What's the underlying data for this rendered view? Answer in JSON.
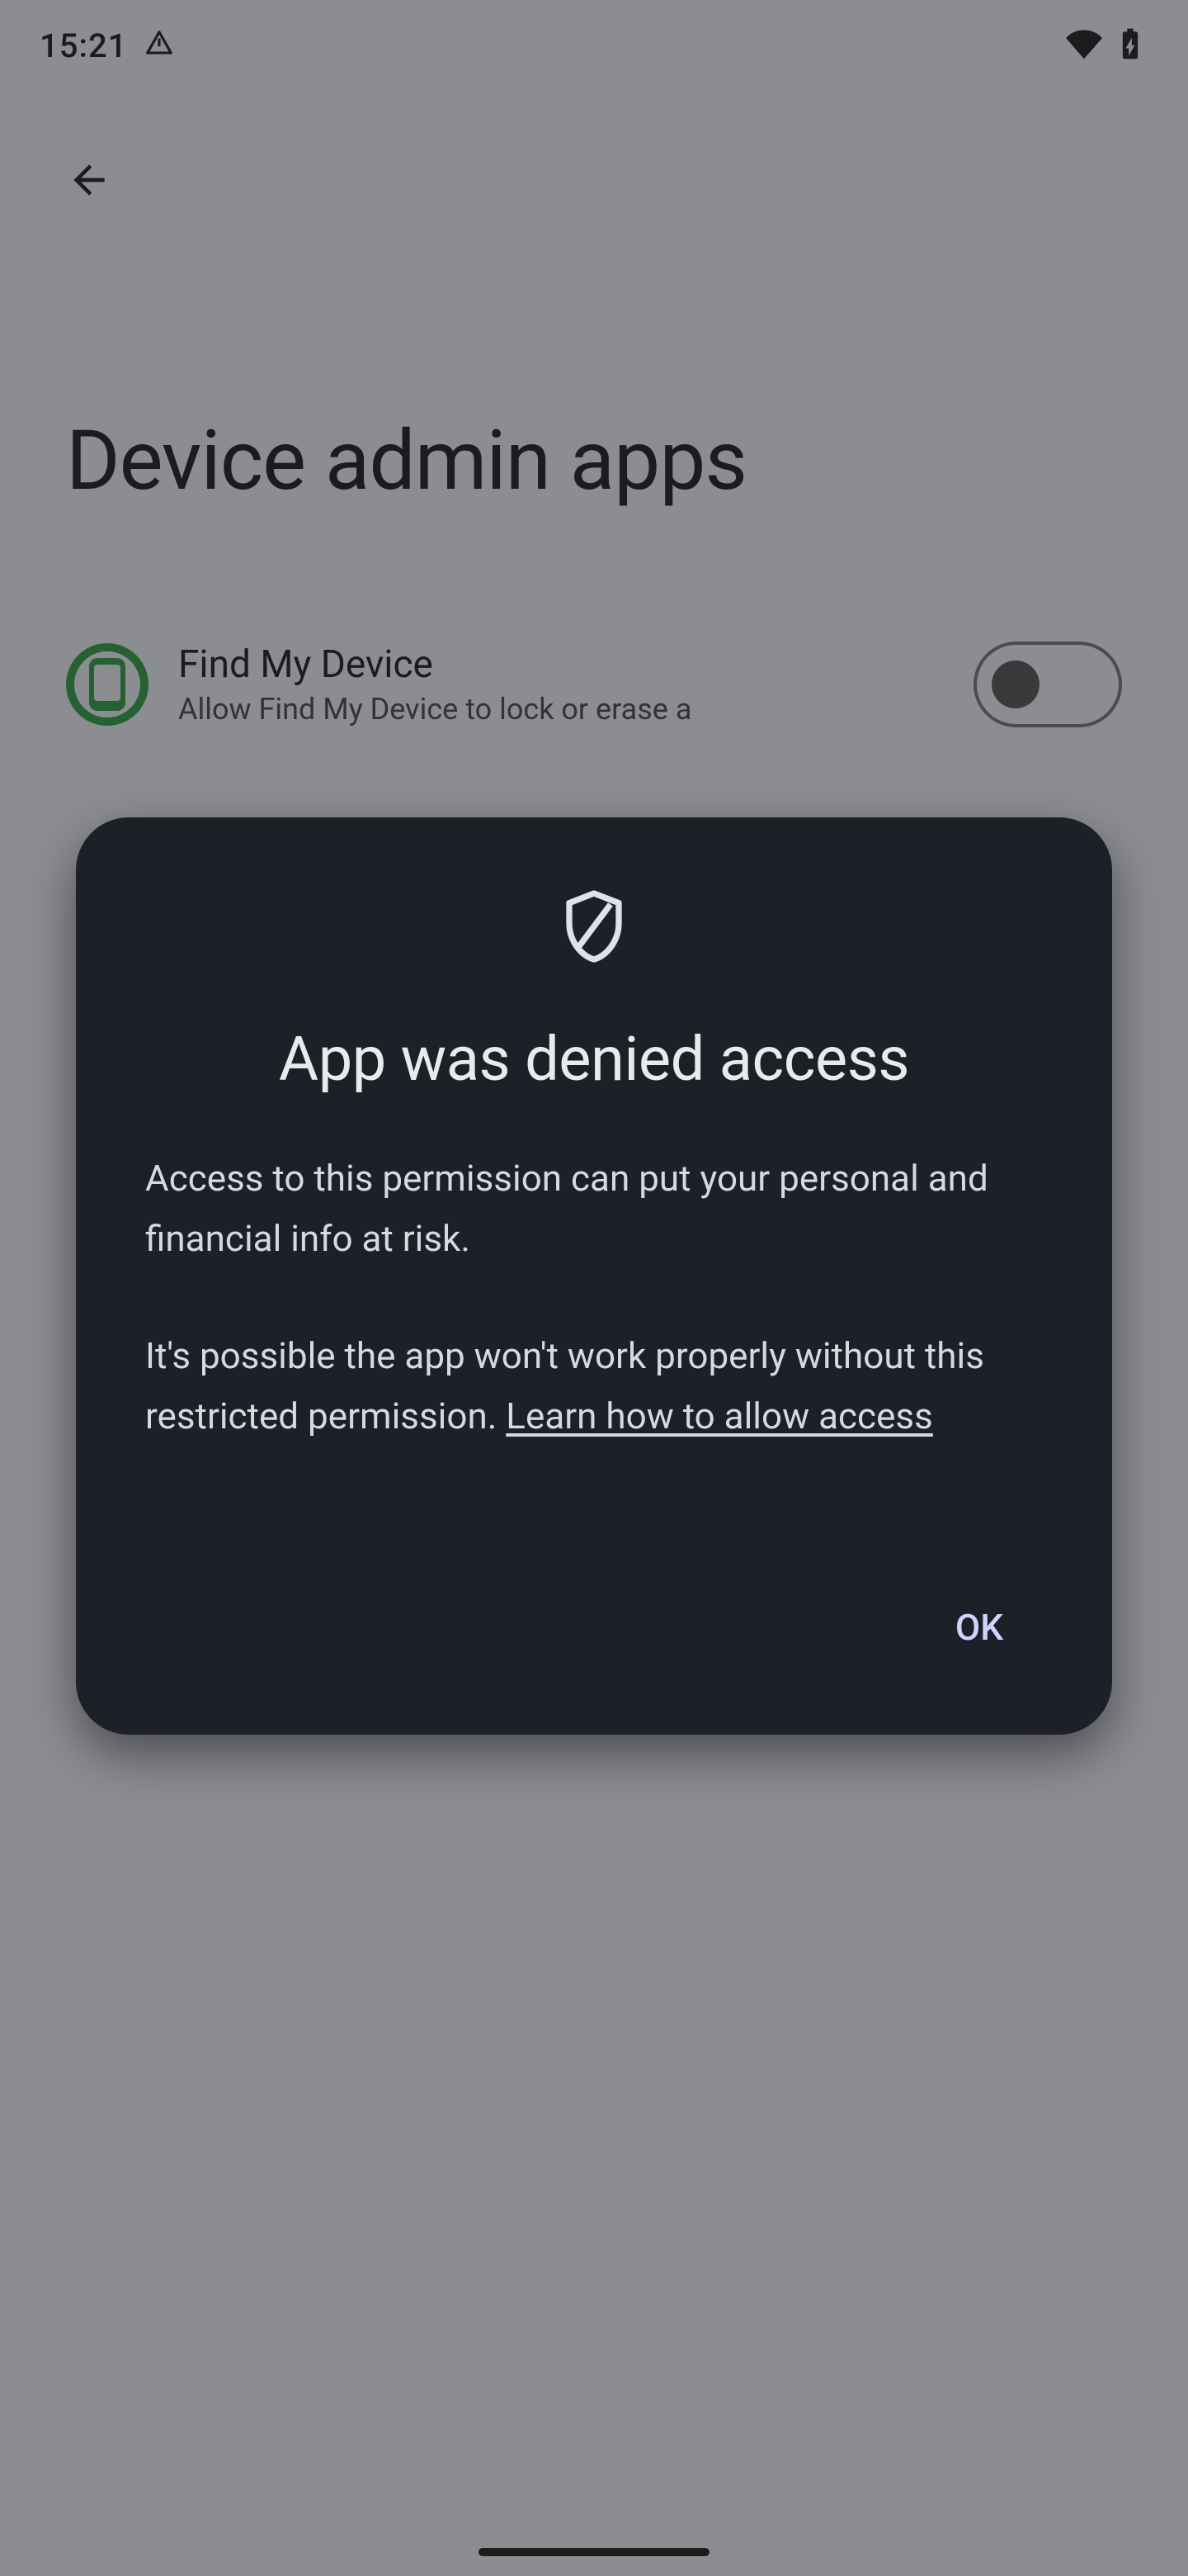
{
  "status": {
    "time": "15:21"
  },
  "page": {
    "title": "Device admin apps"
  },
  "admin_item": {
    "title": "Find My Device",
    "subtitle": "Allow Find My Device to lock or erase a"
  },
  "dialog": {
    "title": "App was denied access",
    "body1": "Access to this permission can put your personal and financial info at risk.",
    "body2a": "It's possible the app won't work properly without this restricted permission. ",
    "link": "Learn how to allow access",
    "ok": "OK"
  }
}
